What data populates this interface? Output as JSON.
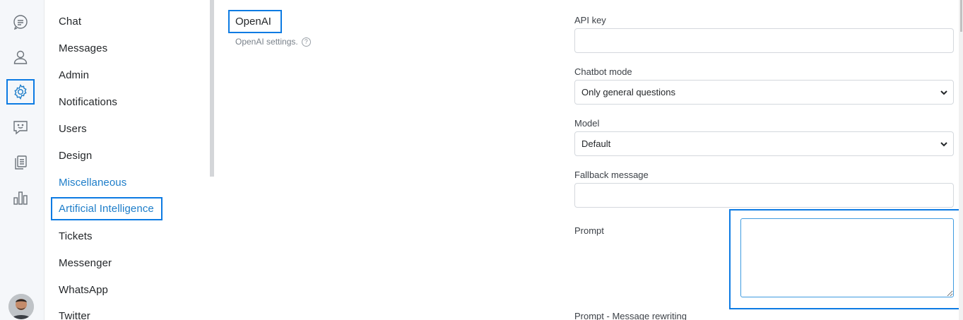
{
  "rail": {
    "items": [
      {
        "icon": "chat-bubble-icon"
      },
      {
        "icon": "user-icon"
      },
      {
        "icon": "gear-icon",
        "active": true
      },
      {
        "icon": "smile-message-icon"
      },
      {
        "icon": "documents-icon"
      },
      {
        "icon": "bar-chart-icon"
      }
    ],
    "accent": "#0d7be3"
  },
  "nav": {
    "items": [
      {
        "label": "Chat"
      },
      {
        "label": "Messages"
      },
      {
        "label": "Admin"
      },
      {
        "label": "Notifications"
      },
      {
        "label": "Users"
      },
      {
        "label": "Design"
      },
      {
        "label": "Miscellaneous"
      },
      {
        "label": "Artificial Intelligence",
        "selected": true
      },
      {
        "label": "Tickets"
      },
      {
        "label": "Messenger"
      },
      {
        "label": "WhatsApp"
      },
      {
        "label": "Twitter"
      }
    ],
    "link_color": "#1d7dc9"
  },
  "section": {
    "title": "OpenAI",
    "description": "OpenAI settings.",
    "help": "?"
  },
  "fields": {
    "api_key": {
      "label": "API key",
      "value": ""
    },
    "chatbot_mode": {
      "label": "Chatbot mode",
      "value": "Only general questions"
    },
    "model": {
      "label": "Model",
      "value": "Default"
    },
    "fallback": {
      "label": "Fallback message",
      "value": ""
    },
    "prompt": {
      "label": "Prompt",
      "value": ""
    },
    "prompt_rewrite": {
      "label": "Prompt - Message rewriting"
    }
  }
}
